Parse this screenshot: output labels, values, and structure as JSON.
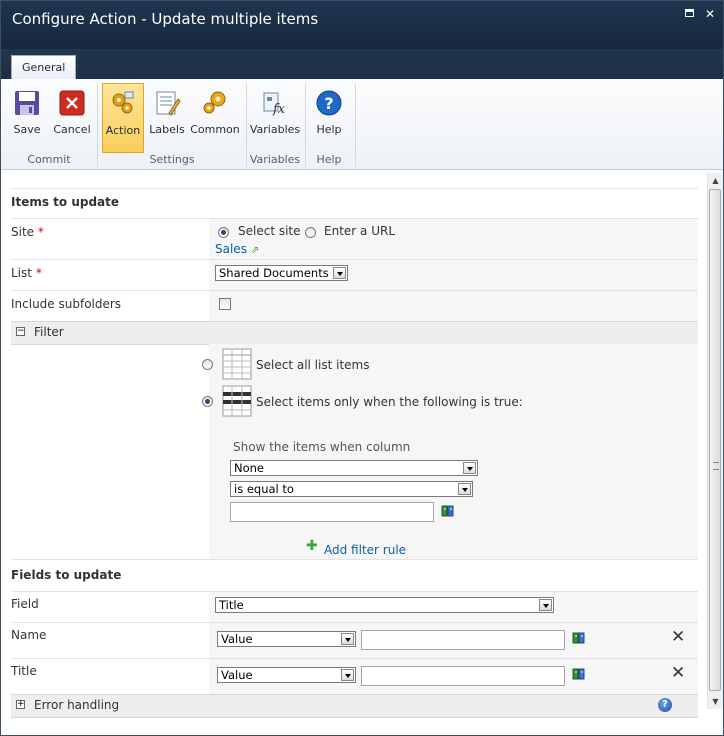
{
  "window": {
    "title": "Configure Action - Update multiple items"
  },
  "ribbon": {
    "tab": "General",
    "buttons": {
      "save": "Save",
      "cancel": "Cancel",
      "action": "Action",
      "labels": "Labels",
      "common": "Common",
      "variables": "Variables",
      "help": "Help"
    },
    "groups": {
      "commit": "Commit",
      "settings": "Settings",
      "variables": "Variables",
      "help": "Help"
    }
  },
  "items_to_update": {
    "heading": "Items to update",
    "site": {
      "label": "Site",
      "required": "*",
      "option_select": "Select site",
      "option_url": "Enter a URL",
      "selected": "select",
      "site_link": "Sales"
    },
    "list": {
      "label": "List",
      "required": "*",
      "value": "Shared Documents"
    },
    "include_subfolders": {
      "label": "Include subfolders",
      "checked": false
    }
  },
  "filter": {
    "heading": "Filter",
    "option_all": "Select all list items",
    "option_when": "Select items only when the following is true:",
    "show_label": "Show the items when column",
    "column_value": "None",
    "operator_value": "is equal to",
    "value_text": "",
    "add_rule": "Add filter rule"
  },
  "fields_to_update": {
    "heading": "Fields to update",
    "field_label": "Field",
    "field_value": "Title",
    "rows": [
      {
        "label": "Name",
        "type": "Value",
        "value": ""
      },
      {
        "label": "Title",
        "type": "Value",
        "value": ""
      }
    ]
  },
  "error_handling": {
    "label": "Error handling"
  },
  "colors": {
    "titlebar": "#1f3550",
    "accent_link": "#0d5fa6",
    "active_button": "#f9cf5b"
  }
}
